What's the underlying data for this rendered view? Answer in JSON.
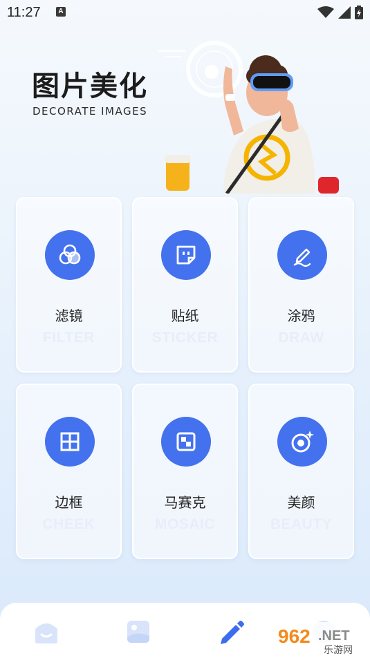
{
  "status": {
    "time": "11:27",
    "notif": "A"
  },
  "header": {
    "title": "图片美化",
    "subtitle": "DECORATE IMAGES"
  },
  "tools": [
    {
      "label": "滤镜",
      "en": "FILTER",
      "icon": "filter-icon"
    },
    {
      "label": "贴纸",
      "en": "STICKER",
      "icon": "sticker-icon"
    },
    {
      "label": "涂鸦",
      "en": "DRAW",
      "icon": "draw-icon"
    },
    {
      "label": "边框",
      "en": "CHEEK",
      "icon": "frame-icon"
    },
    {
      "label": "马赛克",
      "en": "MOSAIC",
      "icon": "mosaic-icon"
    },
    {
      "label": "美颜",
      "en": "BEAUTY",
      "icon": "beauty-icon"
    }
  ],
  "nav": {
    "items": [
      "home-icon",
      "image-icon",
      "edit-icon",
      "profile-icon"
    ],
    "active_index": 2
  },
  "watermark": {
    "text1": "962",
    "text2": ".NET",
    "text3": "乐游网"
  },
  "colors": {
    "accent": "#4471ee",
    "nav_inactive": "#d9e4fb",
    "nav_active": "#3d6cf0"
  }
}
